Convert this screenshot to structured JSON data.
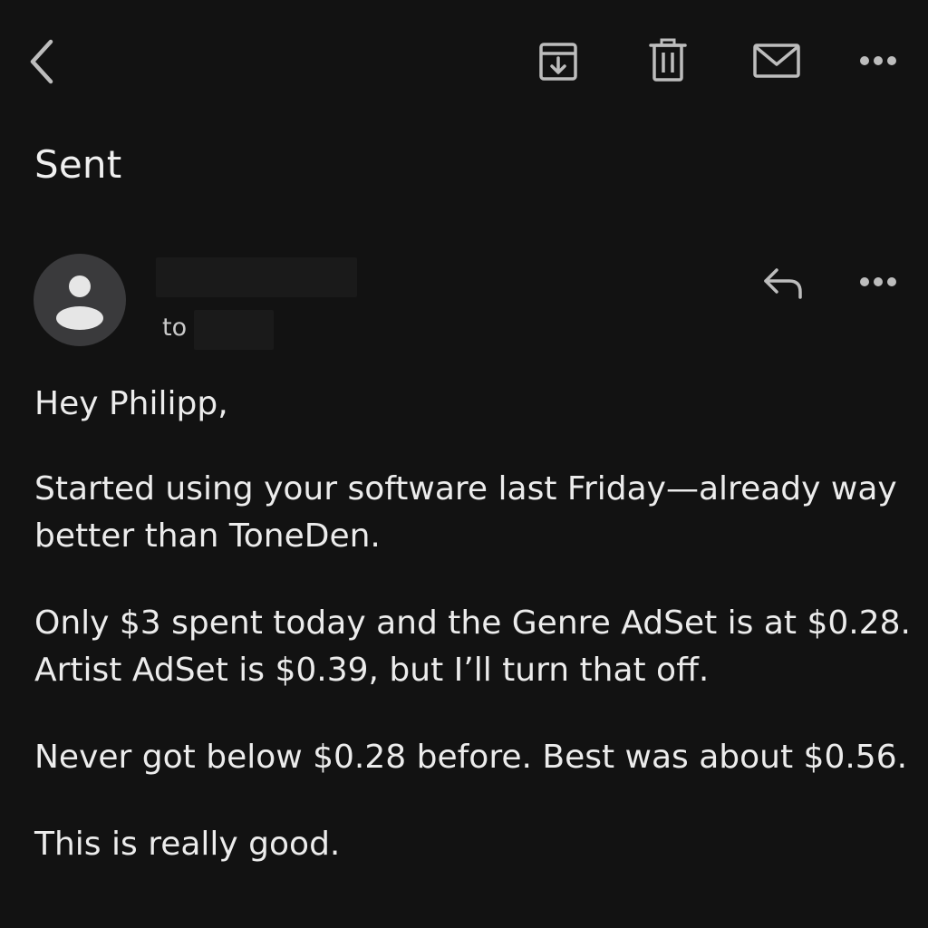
{
  "toolbar": {
    "icons": {
      "back": "chevron-left-icon",
      "archive": "archive-icon",
      "delete": "trash-icon",
      "mark_unread": "mail-icon",
      "more": "more-horizontal-icon"
    }
  },
  "folder_title": "Sent",
  "message": {
    "to_label": "to",
    "icons": {
      "avatar": "person-icon",
      "reply": "reply-icon",
      "more": "more-horizontal-icon"
    },
    "body": {
      "greeting": "Hey Philipp,",
      "paragraph_1": "Started using your software last Friday—already way better than ToneDen.",
      "paragraph_2": "Only $3 spent today and the Genre AdSet is at $0.28. Artist AdSet is $0.39, but I’ll turn that off.",
      "paragraph_3": "Never got below $0.28 before. Best was about $0.56.",
      "paragraph_4": "This is really good."
    }
  },
  "colors": {
    "background": "#121212",
    "text": "#ececec",
    "icon": "#bdbdbd",
    "avatar_bg": "#3a3a3c",
    "avatar_fg": "#e6e6e6",
    "redaction": "#1a1a1a"
  }
}
